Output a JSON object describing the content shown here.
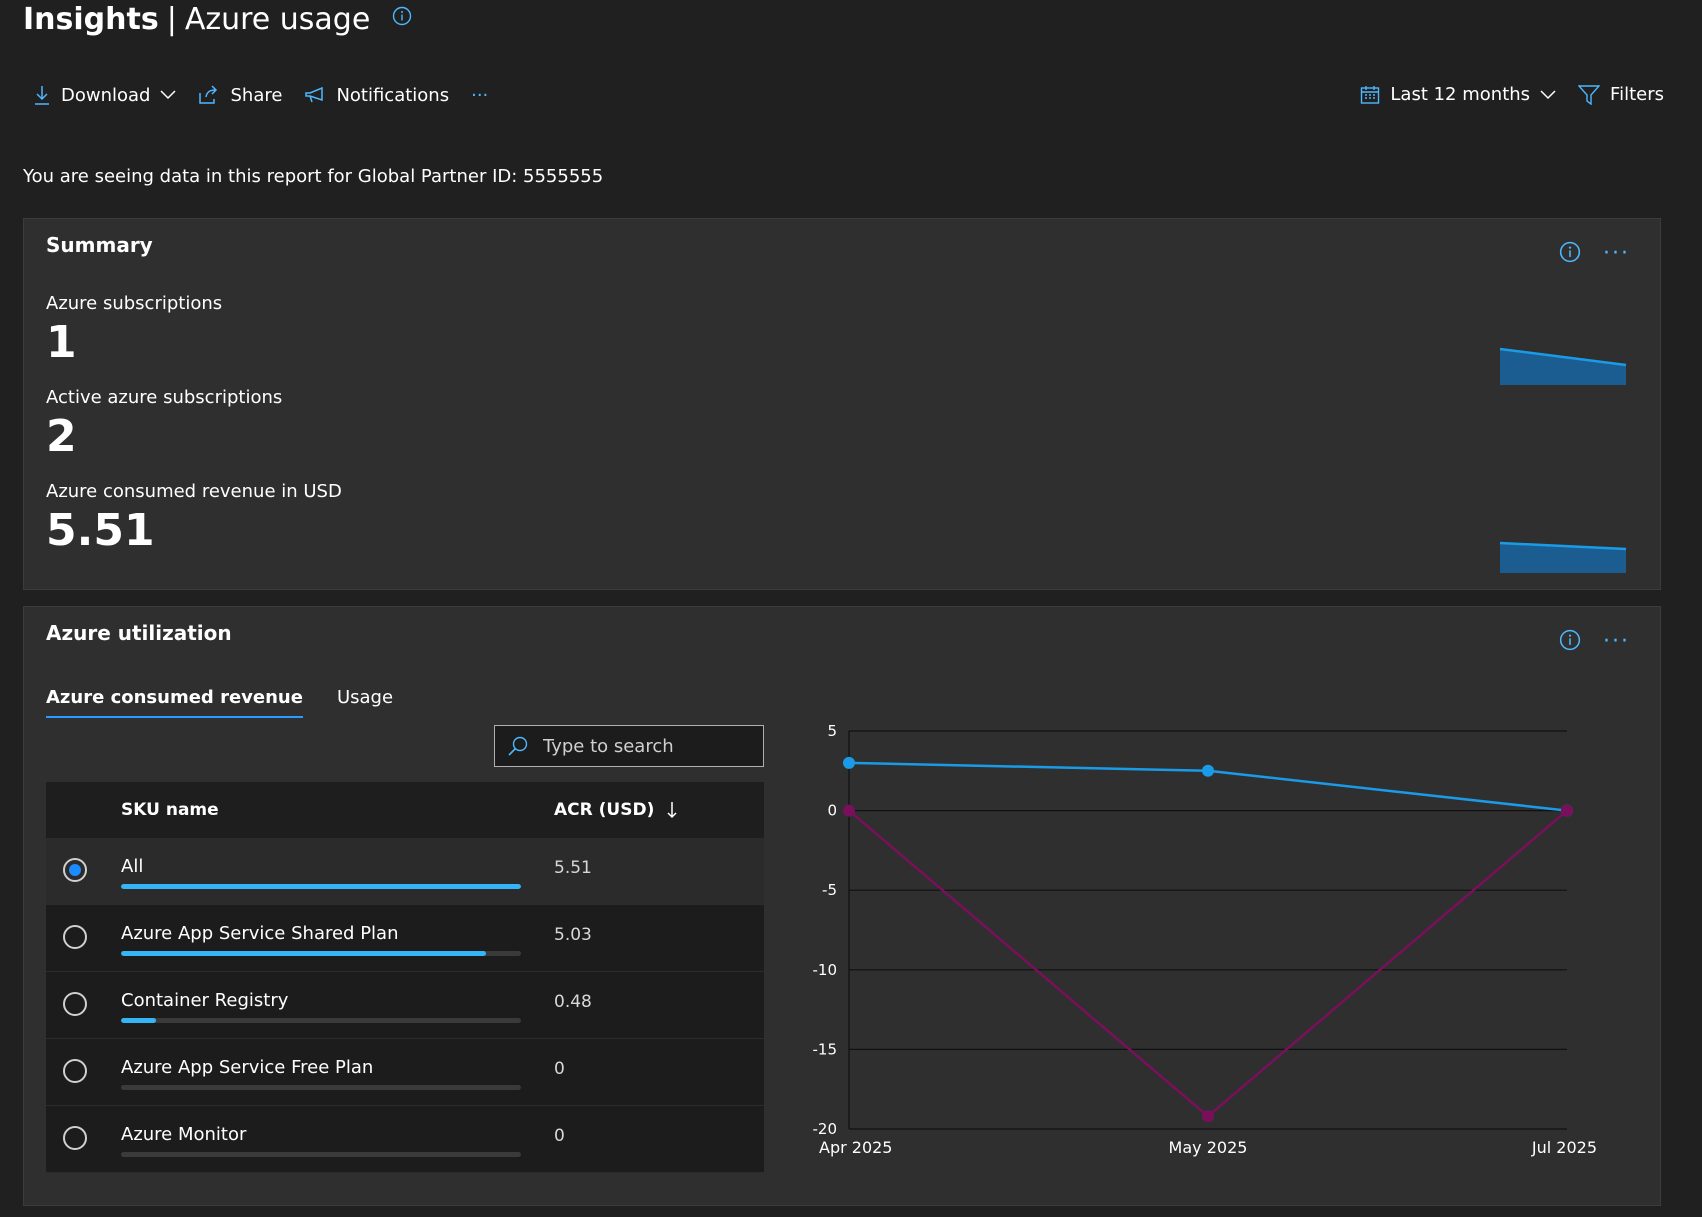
{
  "header": {
    "title_bold": "Insights",
    "title_sep": "|",
    "title_rest": "Azure usage"
  },
  "toolbar": {
    "download": "Download",
    "share": "Share",
    "notifications": "Notifications",
    "more": "···",
    "date_range": "Last 12 months",
    "filters": "Filters"
  },
  "notice": "You are seeing data in this report for Global Partner ID: 5555555",
  "summary": {
    "title": "Summary",
    "metrics": [
      {
        "label": "Azure subscriptions",
        "value": "1"
      },
      {
        "label": "Active azure subscriptions",
        "value": "2"
      },
      {
        "label": "Azure consumed revenue in USD",
        "value": "5.51"
      }
    ]
  },
  "utilization": {
    "title": "Azure utilization",
    "tabs": [
      "Azure consumed revenue",
      "Usage"
    ],
    "search_placeholder": "Type to search",
    "columns": [
      "SKU name",
      "ACR (USD)"
    ],
    "rows": [
      {
        "name": "All",
        "value": "5.51",
        "selected": true,
        "fraction": 1.0
      },
      {
        "name": "Azure App Service Shared Plan",
        "value": "5.03",
        "selected": false,
        "fraction": 0.913
      },
      {
        "name": "Container Registry",
        "value": "0.48",
        "selected": false,
        "fraction": 0.087
      },
      {
        "name": "Azure App Service Free Plan",
        "value": "0",
        "selected": false,
        "fraction": 0
      },
      {
        "name": "Azure Monitor",
        "value": "0",
        "selected": false,
        "fraction": 0
      }
    ]
  },
  "colors": {
    "accent": "#2a9cff",
    "series_blue": "#1a9be8",
    "series_purple": "#7a0f5c"
  },
  "chart_data": {
    "type": "line",
    "x": [
      "Apr 2025",
      "May 2025",
      "Jul 2025"
    ],
    "yticks": [
      "5",
      "0",
      "-5",
      "-10",
      "-15",
      "-20"
    ],
    "ylim": [
      -20,
      5
    ],
    "grid": true,
    "series": [
      {
        "values": [
          3,
          2.5,
          0
        ],
        "color": "#1a9be8"
      },
      {
        "values": [
          0,
          -19.2,
          0
        ],
        "color": "#7a0f5c"
      }
    ]
  }
}
